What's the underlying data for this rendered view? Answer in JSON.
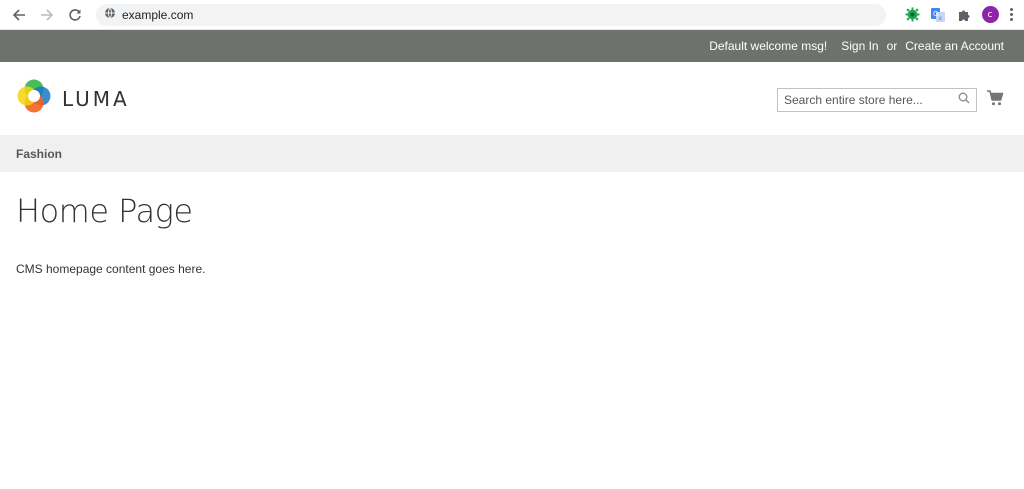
{
  "browser": {
    "url": "example.com",
    "profile_initial": "c"
  },
  "top_panel": {
    "welcome": "Default welcome msg!",
    "sign_in": "Sign In",
    "or": "or",
    "create_account": "Create an Account"
  },
  "header": {
    "logo_text": "LUMA",
    "search_placeholder": "Search entire store here..."
  },
  "nav": {
    "items": [
      {
        "label": "Fashion"
      }
    ]
  },
  "main": {
    "title": "Home Page",
    "content": "CMS homepage content goes here."
  },
  "colors": {
    "panel_bg": "#6e716e",
    "nav_bg": "#f0f0f0",
    "logo_orange": "#f26322",
    "logo_yellow": "#f6d60b",
    "logo_green": "#37b44a",
    "logo_blue": "#1979c3"
  },
  "icons": {
    "back": "arrow-left-icon",
    "forward": "arrow-right-icon",
    "reload": "reload-icon",
    "site_info": "globe-icon",
    "ext_green": "extension-gear-icon",
    "ext_translate": "translate-icon",
    "ext_puzzle": "puzzle-icon",
    "menu": "kebab-menu-icon",
    "search": "search-icon",
    "cart": "cart-icon"
  }
}
